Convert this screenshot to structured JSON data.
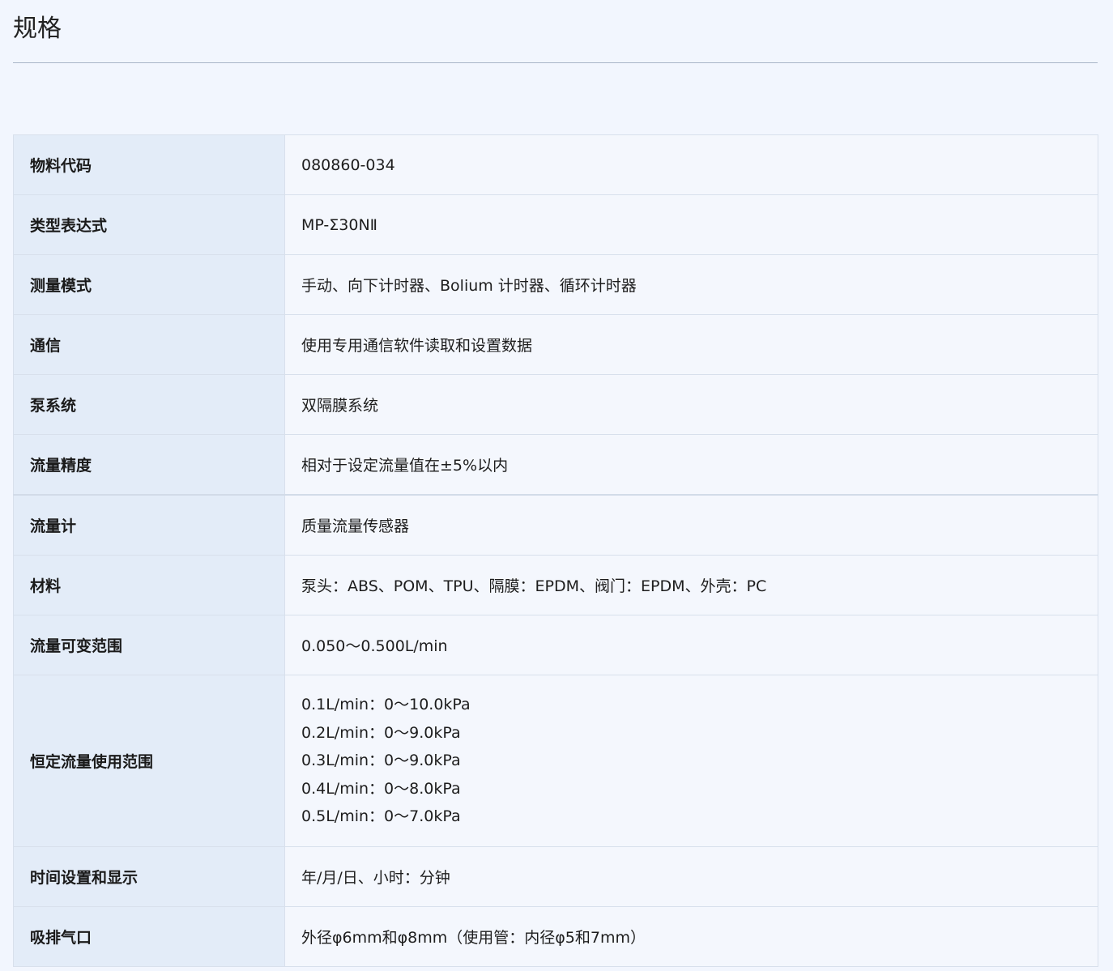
{
  "page": {
    "title": "规格"
  },
  "specs": {
    "rows": [
      {
        "label": "物料代码",
        "value": "080860-034"
      },
      {
        "label": "类型表达式",
        "value": "MP-Σ30NⅡ"
      },
      {
        "label": "测量模式",
        "value": "手动、向下计时器、Bolium 计时器、循环计时器"
      },
      {
        "label": "通信",
        "value": "使用专用通信软件读取和设置数据"
      },
      {
        "label": "泵系统",
        "value": "双隔膜系统"
      },
      {
        "label": "流量精度",
        "value": "相对于设定流量值在±5%以内"
      },
      {
        "label": "流量计",
        "value": "质量流量传感器"
      },
      {
        "label": "材料",
        "value": "泵头：ABS、POM、TPU、隔膜：EPDM、阀门：EPDM、外壳：PC"
      },
      {
        "label": "流量可变范围",
        "value": "0.050～0.500L/min"
      },
      {
        "label": "恒定流量使用范围",
        "lines": [
          "0.1L/min：0～10.0kPa",
          "0.2L/min：0～9.0kPa",
          "0.3L/min：0～9.0kPa",
          "0.4L/min：0～8.0kPa",
          "0.5L/min：0～7.0kPa"
        ]
      },
      {
        "label": "时间设置和显示",
        "value": "年/月/日、小时：分钟"
      },
      {
        "label": "吸排气口",
        "value": "外径φ6mm和φ8mm（使用管：内径φ5和7mm）"
      }
    ]
  }
}
